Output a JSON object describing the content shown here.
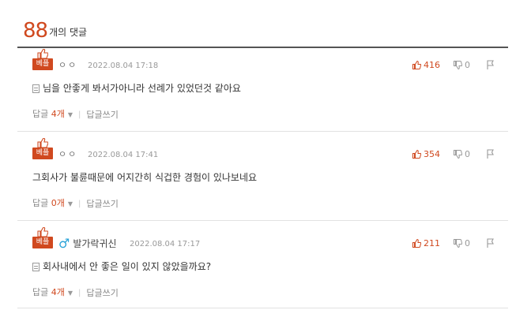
{
  "header": {
    "count": "88",
    "suffix": "개의 댓글"
  },
  "comments": [
    {
      "badge": "베플",
      "author": "ㅇㅇ",
      "date": "2022.08.04 17:18",
      "likes": "416",
      "dislikes": "0",
      "text": "님을 안좋게 봐서가아니라 선례가 있었던것 같아요",
      "has_memo": true,
      "reply_label": "답글",
      "reply_count": "4개",
      "write_reply": "답글쓰기"
    },
    {
      "badge": "베플",
      "author": "ㅇㅇ",
      "date": "2022.08.04 17:41",
      "likes": "354",
      "dislikes": "0",
      "text": "그회사가 불륜때문에 어지간히 식겁한 경험이 있나보네요",
      "has_memo": false,
      "reply_label": "답글",
      "reply_count": "0개",
      "write_reply": "답글쓰기"
    },
    {
      "badge": "베플",
      "author": "발가락귀신",
      "author_icon": "male-icon",
      "date": "2022.08.04 17:17",
      "likes": "211",
      "dislikes": "0",
      "text": "회사내에서 안 좋은 일이 있지 않았을까요?",
      "has_memo": true,
      "reply_label": "답글",
      "reply_count": "4개",
      "write_reply": "답글쓰기"
    }
  ],
  "colors": {
    "accent": "#d0491f",
    "male": "#2aa3d8",
    "muted": "#999999"
  }
}
